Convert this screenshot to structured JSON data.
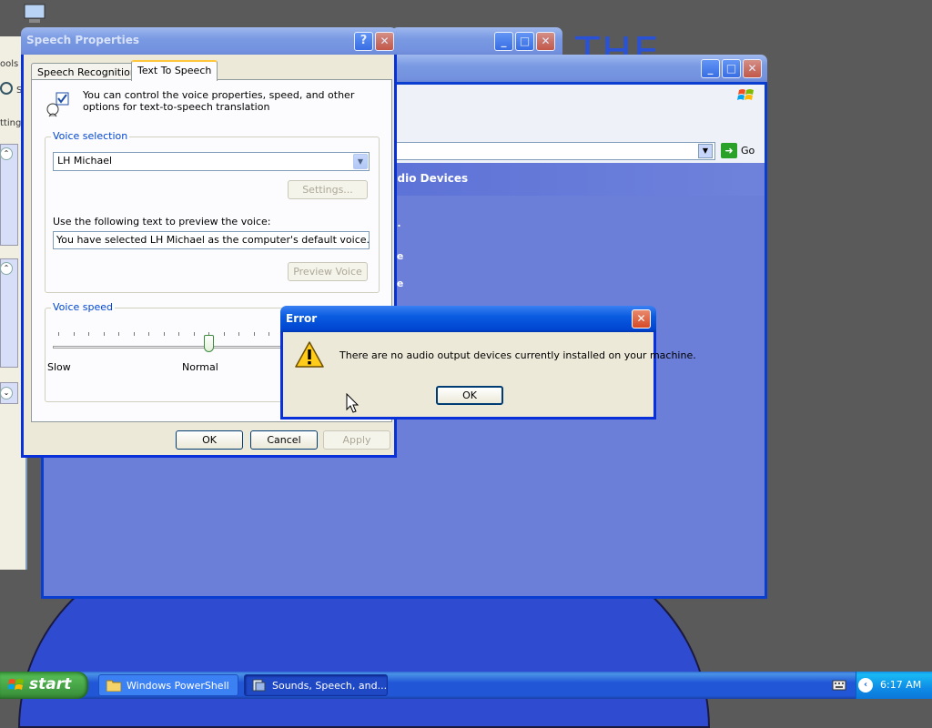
{
  "desktop": {
    "wallpaper_text": "THE"
  },
  "explorer_window": {
    "address_go_label": "Go",
    "panel_header": "udio Devices",
    "items": [
      "...",
      "ne",
      "ne"
    ]
  },
  "left_window": {
    "menu_fragment": "ools",
    "search_fragment": "S",
    "settings_fragment": "ttings"
  },
  "speech_dialog": {
    "title": "Speech Properties",
    "tabs": [
      "Speech Recognition",
      "Text To Speech"
    ],
    "active_tab": "Text To Speech",
    "intro_text": "You can control the voice properties, speed, and other options for text-to-speech translation",
    "voice_selection": {
      "group_title": "Voice selection",
      "selected_voice": "LH Michael",
      "settings_label": "Settings...",
      "preview_label": "Use the following text to preview the voice:",
      "preview_text": "You have selected LH Michael as the computer's default voice.",
      "preview_button": "Preview Voice"
    },
    "voice_speed": {
      "group_title": "Voice speed",
      "slow_label": "Slow",
      "normal_label": "Normal",
      "level": 0.5
    },
    "buttons": {
      "ok": "OK",
      "cancel": "Cancel",
      "apply": "Apply"
    }
  },
  "error_dialog": {
    "title": "Error",
    "message": "There are no audio output devices currently installed on your machine.",
    "ok_label": "OK"
  },
  "taskbar": {
    "start_label": "start",
    "tasks": [
      {
        "label": "Windows PowerShell",
        "icon": "folder-icon",
        "active": false
      },
      {
        "label": "Sounds, Speech, and...",
        "icon": "control-panel-icon",
        "active": true
      }
    ],
    "clock": "6:17 AM"
  },
  "colors": {
    "xp_blue": "#0a5ce0",
    "group_title": "#0046d5",
    "start_green": "#3d963d"
  }
}
